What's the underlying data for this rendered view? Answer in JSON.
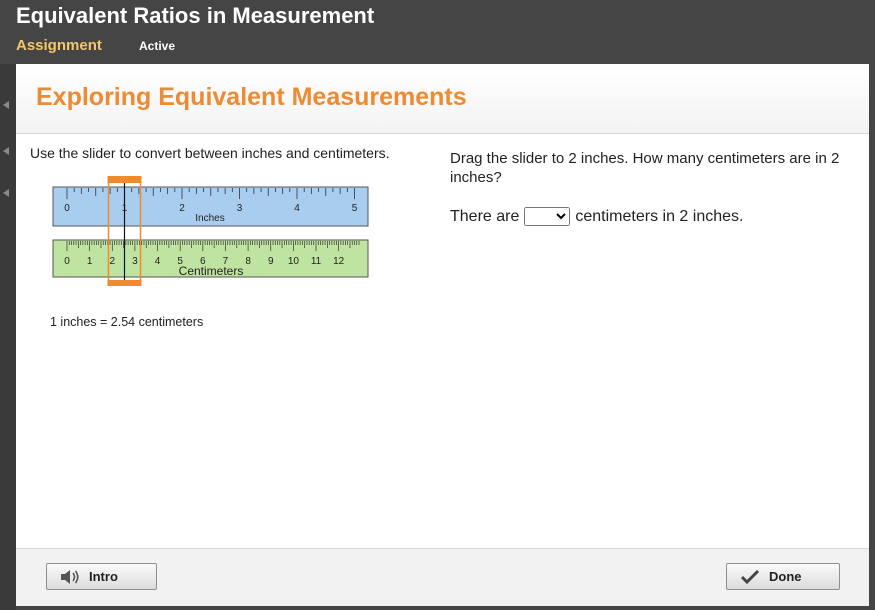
{
  "topbar": {
    "title": "Equivalent Ratios in Measurement",
    "assignment_label": "Assignment",
    "status": "Active"
  },
  "main": {
    "page_title": "Exploring Equivalent Measurements",
    "instruction": "Use the slider to convert between inches and centimeters.",
    "ruler": {
      "inches_label": "Inches",
      "centimeters_label": "Centimeters",
      "inch_ticks": [
        "0",
        "1",
        "2",
        "3",
        "4",
        "5"
      ],
      "cm_ticks": [
        "0",
        "1",
        "2",
        "3",
        "4",
        "5",
        "6",
        "7",
        "8",
        "9",
        "10",
        "11",
        "12"
      ],
      "slider_value_inches": 1
    },
    "equivalence": "1 inches = 2.54 centimeters",
    "question": "Drag the slider to 2 inches. How many centimeters are in 2 inches?",
    "answer": {
      "prefix": "There are",
      "suffix": "centimeters in 2 inches.",
      "selected_value": ""
    }
  },
  "footer": {
    "intro_label": "Intro",
    "done_label": "Done"
  },
  "colors": {
    "accent": "#ee8a32",
    "inch_bar": "#a9cdef",
    "cm_bar": "#bfe3a0",
    "slider": "#f08a2c"
  }
}
